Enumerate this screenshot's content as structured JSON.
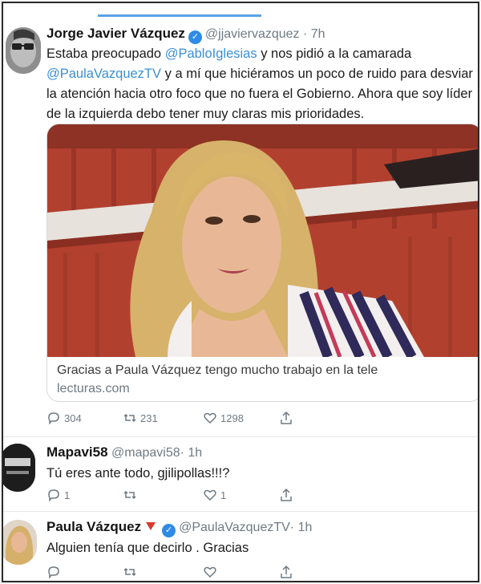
{
  "tweet1": {
    "name": "Jorge Javier Vázquez",
    "handle": "@jjaviervazquez",
    "time": "· 7h",
    "text_parts": [
      "Estaba preocupado ",
      "@PabloIglesias",
      " y nos pidió a la camarada ",
      "@PaulaVazquezTV",
      " y a mí que hiciéramos un poco de ruido para desviar la atención hacia otro foco que no fuera el Gobierno. Ahora que soy líder de la izquierda debo tener muy claras mis prioridades."
    ],
    "card": {
      "title": "Gracias a Paula Vázquez tengo mucho trabajo en la tele",
      "domain": "lecturas.com"
    },
    "actions": {
      "replies": "304",
      "retweets": "231",
      "likes": "1298"
    }
  },
  "tweet2": {
    "name": "Mapavi58",
    "handle": "@mapavi58",
    "time": "· 1h",
    "text": "Tú eres ante todo, gjilipollas!!!?",
    "actions": {
      "replies": "1",
      "retweets": "",
      "likes": "1"
    }
  },
  "tweet3": {
    "name": "Paula Vázquez",
    "handle": "@PaulaVazquezTV",
    "time": "· 1h",
    "text": "Alguien tenía que decirlo . Gracias",
    "actions": {
      "replies": "",
      "retweets": "",
      "likes": ""
    }
  },
  "colors": {
    "accent": "#3a8fd8",
    "verified": "#2f8be5",
    "muted": "#6f7a84"
  }
}
